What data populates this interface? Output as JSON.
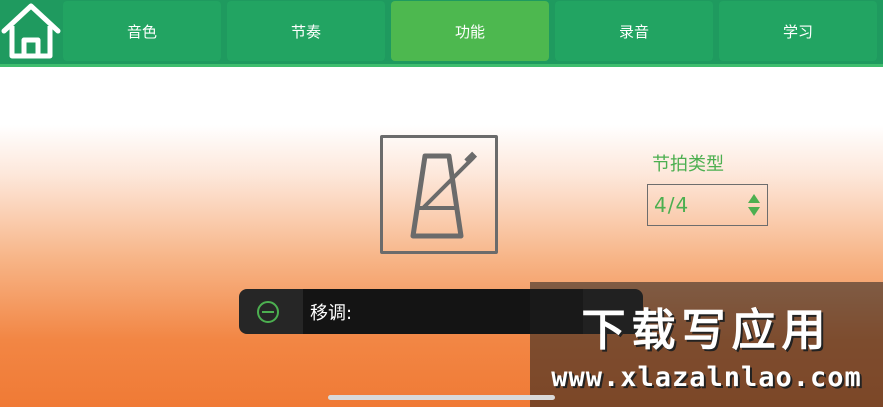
{
  "nav": {
    "home_icon": "home-icon",
    "tabs": [
      {
        "label": "音色",
        "active": false
      },
      {
        "label": "节奏",
        "active": false
      },
      {
        "label": "功能",
        "active": true
      },
      {
        "label": "录音",
        "active": false
      },
      {
        "label": "学习",
        "active": false
      }
    ]
  },
  "metronome": {
    "icon": "metronome-icon"
  },
  "meter": {
    "label": "节拍类型",
    "value": "4/4"
  },
  "transpose": {
    "label": "移调:"
  },
  "watermark": {
    "title": "下载写应用",
    "url": "www.xlazalnlao.com"
  },
  "colors": {
    "nav_bg": "#1f9a5f",
    "tab_bg": "#22a462",
    "tab_active": "#4db84f",
    "accent_green": "#4caf50"
  }
}
